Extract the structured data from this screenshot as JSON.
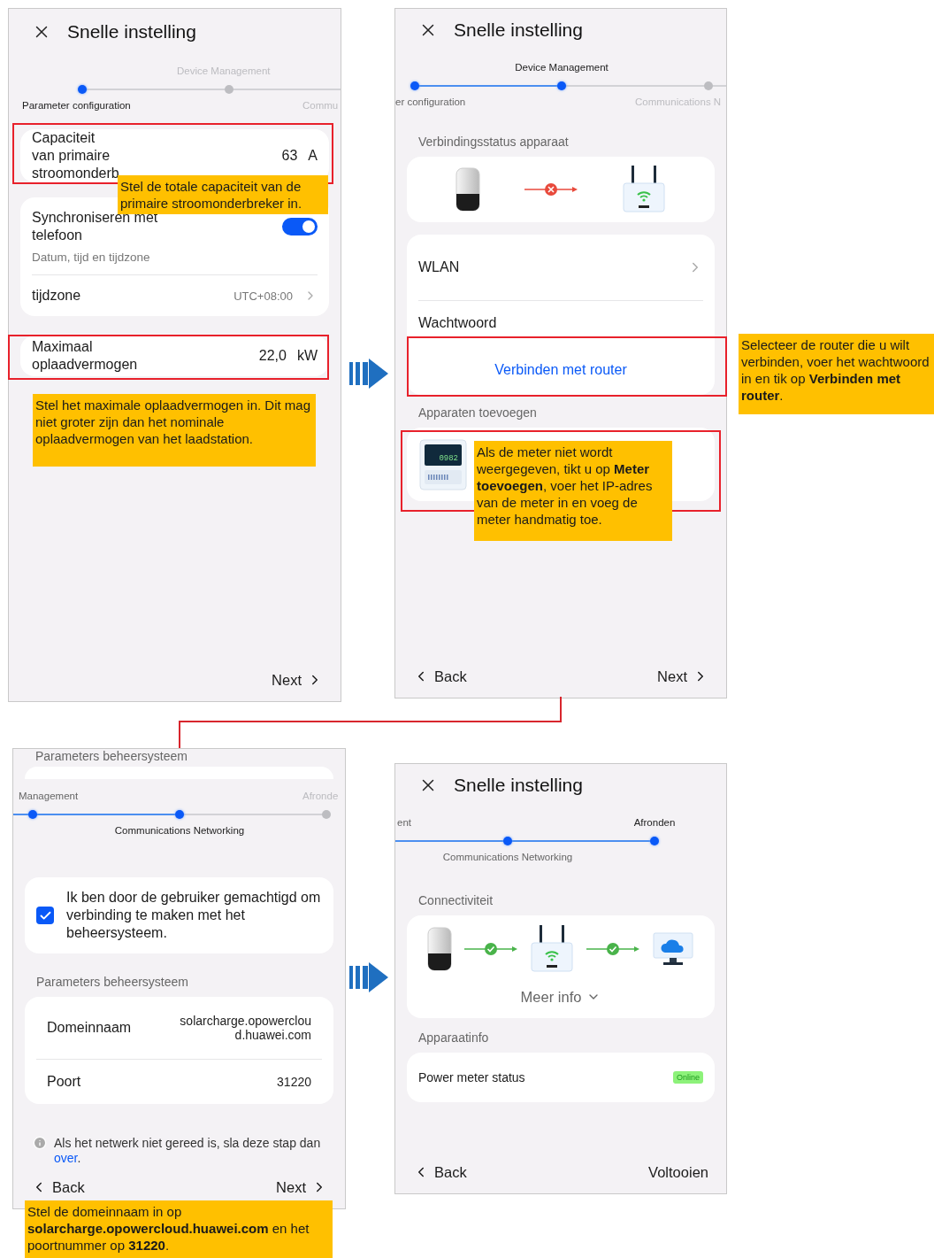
{
  "parameter_screen": {
    "title": "Snelle instelling",
    "steps": [
      {
        "label": "Parameter configuration",
        "selected": true,
        "done": false
      },
      {
        "label": "Device Management",
        "selected": false,
        "done": false
      },
      {
        "label": "Commu",
        "selected": false,
        "done": false
      }
    ],
    "breaker": {
      "label_lines": [
        "Capaciteit",
        "van primaire",
        "stroomonderb"
      ],
      "value": "63",
      "unit": "A"
    },
    "sync": {
      "label_lines": [
        "Synchroniseren met",
        "telefoon"
      ],
      "on": true,
      "hint": "Datum, tijd en tijdzone"
    },
    "timezone": {
      "label": "tijdzone",
      "value": "UTC+08:00"
    },
    "charge_power": {
      "label_lines": [
        "Maximaal",
        "oplaadvermogen"
      ],
      "value": "22,0",
      "unit": "kW"
    },
    "next": "Next",
    "callouts": [
      "Stel de totale capaciteit van de primaire stroomonderbreker in.",
      "Stel het maximale oplaadvermogen in. Dit mag niet groter zijn dan het nominale oplaadvermogen van het laadstation."
    ]
  },
  "device_screen": {
    "title": "Snelle instelling",
    "steps": [
      {
        "label": "er configuration",
        "selected": false,
        "done": true
      },
      {
        "label": "Device Management",
        "selected": true,
        "done": false
      },
      {
        "label": "Communications N",
        "selected": false,
        "done": false
      }
    ],
    "status_heading": "Verbindingsstatus apparaat",
    "links": [
      {
        "connected": false
      }
    ],
    "wlan": "WLAN",
    "password": "Wachtwoord",
    "connect": "Verbinden met router",
    "devices_heading": "Apparaten toevoegen",
    "meter_display": "0982",
    "back": "Back",
    "next": "Next",
    "callouts": [
      "Als de meter niet wordt weergegeven, tikt u op **Meter toevoegen**, voer het IP-adres van de meter in en voeg de meter handmatig toe.",
      "Selecteer de router die u wilt verbinden, voer het wachtwoord in en tik op **Verbinden met router**."
    ]
  },
  "network_screen": {
    "top_heading": "Parameters beheersysteem",
    "steps": [
      {
        "label": "Management",
        "selected": false,
        "done": true
      },
      {
        "label": "Communications Networking",
        "selected": true,
        "done": false
      },
      {
        "label": "Afronde",
        "selected": false,
        "done": false
      }
    ],
    "consent": {
      "text": "Ik ben door de gebruiker gemachtigd om verbinding te maken met het beheersysteem.",
      "checked": true
    },
    "params_heading": "Parameters beheersysteem",
    "domain": {
      "label": "Domeinnaam",
      "value": "solarcharge.opowercloud.huawei.com"
    },
    "port": {
      "label": "Poort",
      "value": "31220"
    },
    "info": {
      "text": "Als het netwerk niet gereed is, sla deze stap dan",
      "link": "over",
      "end": "."
    },
    "back": "Back",
    "next": "Next",
    "callout": "Stel de domeinnaam in op **solarcharge.opowercloud.huawei.com** en het poortnummer op **31220**."
  },
  "finish_screen": {
    "title": "Snelle instelling",
    "steps": [
      {
        "label": "ent",
        "selected": false,
        "done": true
      },
      {
        "label": "Communications Networking",
        "selected": false,
        "done": true
      },
      {
        "label": "Afronden",
        "selected": true,
        "done": false
      }
    ],
    "connectivity_heading": "Connectiviteit",
    "links": [
      {
        "connected": true
      },
      {
        "connected": true
      }
    ],
    "more_info": "Meer info",
    "device_heading": "Apparaatinfo",
    "meter_status": {
      "label": "Power meter status",
      "status": "Online",
      "online": true
    },
    "back": "Back",
    "finish": "Voltooien"
  }
}
